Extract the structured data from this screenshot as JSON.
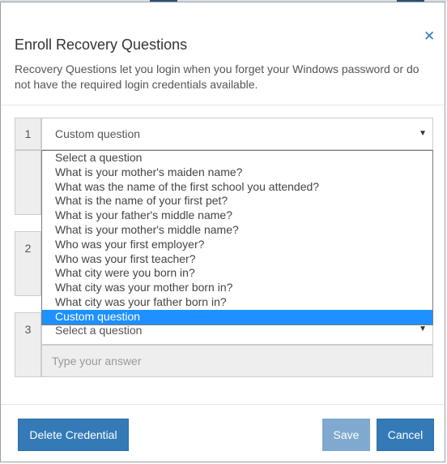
{
  "dialog": {
    "title": "Enroll Recovery Questions",
    "description": "Recovery Questions let you login when you forget your Windows password or do not have the required login credentials available.",
    "close_icon": "close-icon"
  },
  "questions": [
    {
      "number": "1",
      "selected": "Custom question"
    },
    {
      "number": "2"
    },
    {
      "number": "3",
      "selected": "Select a question",
      "answer_placeholder": "Type your answer"
    }
  ],
  "dropdown": {
    "options": [
      "Select a question",
      "What is your mother's maiden name?",
      "What was the name of the first school you attended?",
      "What is the name of your first pet?",
      "What is your father's middle name?",
      "What is your mother's middle name?",
      "Who was your first employer?",
      "Who was your first teacher?",
      "What city were you born in?",
      "What city was your mother born in?",
      "What city was your father born in?",
      "Custom question"
    ],
    "selected_index": 11
  },
  "buttons": {
    "delete": "Delete Credential",
    "save": "Save",
    "cancel": "Cancel"
  },
  "colors": {
    "primary": "#337ab7",
    "primary_disabled": "#7fa9cf",
    "highlight": "#1e90ff"
  }
}
